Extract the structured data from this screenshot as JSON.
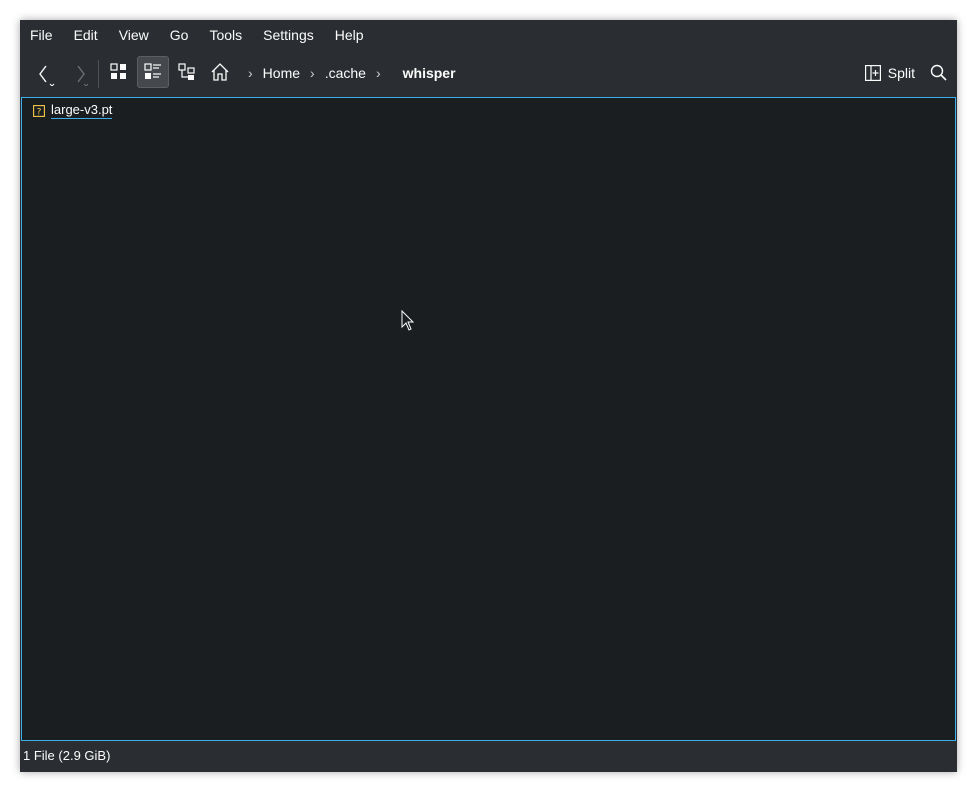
{
  "menubar": {
    "items": [
      "File",
      "Edit",
      "View",
      "Go",
      "Tools",
      "Settings",
      "Help"
    ]
  },
  "toolbar": {
    "back_icon": "arrow-left-icon",
    "forward_icon": "arrow-right-icon",
    "view_modes": [
      "icons-view-icon",
      "details-view-icon",
      "tree-view-icon"
    ],
    "home_icon": "home-icon",
    "split_label": "Split",
    "search_icon": "search-icon"
  },
  "breadcrumb": {
    "items": [
      "Home",
      ".cache",
      "whisper"
    ]
  },
  "files": [
    {
      "name": "large-v3.pt",
      "icon": "unknown-file-icon"
    }
  ],
  "status": {
    "text": "1 File (2.9 GiB)"
  },
  "colors": {
    "window_bg": "#2a2e32",
    "view_bg": "#1b1e20",
    "accent": "#3daee9",
    "file_icon": "#f7c948"
  }
}
